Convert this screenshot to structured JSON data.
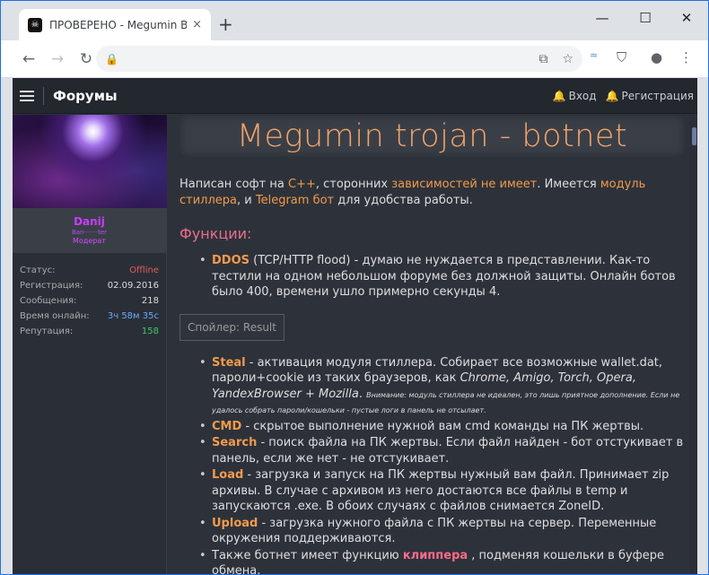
{
  "browser": {
    "tab_title": "ПРОВЕРЕНО - Megumin Botnet |",
    "tab_close": "×",
    "new_tab": "+",
    "minimize": "—",
    "maximize": "☐",
    "close": "✕"
  },
  "nav": {
    "brand": "Форумы",
    "login": "Вход",
    "register": "Регистрация"
  },
  "user": {
    "name": "Danij",
    "title": "Ban·······ter",
    "role": "Модерат",
    "stats": [
      {
        "label": "Статус:",
        "value": "Offline",
        "color": "#e05b5b"
      },
      {
        "label": "Регистрация:",
        "value": "02.09.2016",
        "color": "#dddddd"
      },
      {
        "label": "Сообщения:",
        "value": "218",
        "color": "#dddddd"
      },
      {
        "label": "Время онлайн:",
        "value": "3ч 58м 35с",
        "color": "#6aa7ff"
      },
      {
        "label": "Репутация:",
        "value": "158",
        "color": "#3ec86a"
      }
    ]
  },
  "post": {
    "banner": "Megumin trojan - botnet",
    "intro": {
      "p1": "Написан софт на ",
      "k1": "C++",
      "p2": ", сторонних ",
      "k2": "зависимостей не имеет",
      "p3": ". Имеется ",
      "k3": "модуль стиллера",
      "p4": ", и ",
      "k4": "Telegram бот",
      "p5": " для удобства работы."
    },
    "functions_title": "Функции:",
    "ddos": {
      "kw": "DDOS",
      "text": " (TCP/HTTP flood) - думаю не нуждается в представлении. Как-то тестили на одном небольшом форуме без должной защиты. Онлайн ботов было 400, времени ушло примерно секунды 4."
    },
    "spoiler": "Спойлер: Result",
    "steal": {
      "kw": "Steal",
      "text1": " - активация модуля стиллера. Собирает все возможные wallet.dat, пароли+cookie из таких браузеров, как ",
      "browsers": "Chrome, Amigo, Torch, Opera, YandexBrowser + Mozilla",
      "text2": ". ",
      "note": "Внимание: модуль стиллера не идеален, это лишь приятное дополнение. Если не удалось собрать пароли/кошельки - пустые логи в панель не отсылает."
    },
    "cmd": {
      "kw": "CMD",
      "text": " - скрытое выполнение нужной вам cmd команды на ПК жертвы."
    },
    "search": {
      "kw": "Search",
      "text": " - поиск файла на ПК жертвы. Если файл найден - бот отстукивает в панель, если же нет - не отстукивает."
    },
    "load": {
      "kw": "Load",
      "text": " - загрузка и запуск на ПК жертвы нужный вам файл. Принимает zip архивы. В случае с архивом из него достаются все файлы в temp и запускаются .exe. В обоих случаях с файлов снимается ZoneID."
    },
    "upload": {
      "kw": "Upload",
      "text": " - загрузка нужного файла с ПК жертвы на сервер. Переменные окружения поддерживаются."
    },
    "clipper": {
      "text1": "Также ботнет имеет функцию ",
      "kw": "клиппера",
      "text2": " , подменяя кошельки в буфере обмена."
    }
  }
}
